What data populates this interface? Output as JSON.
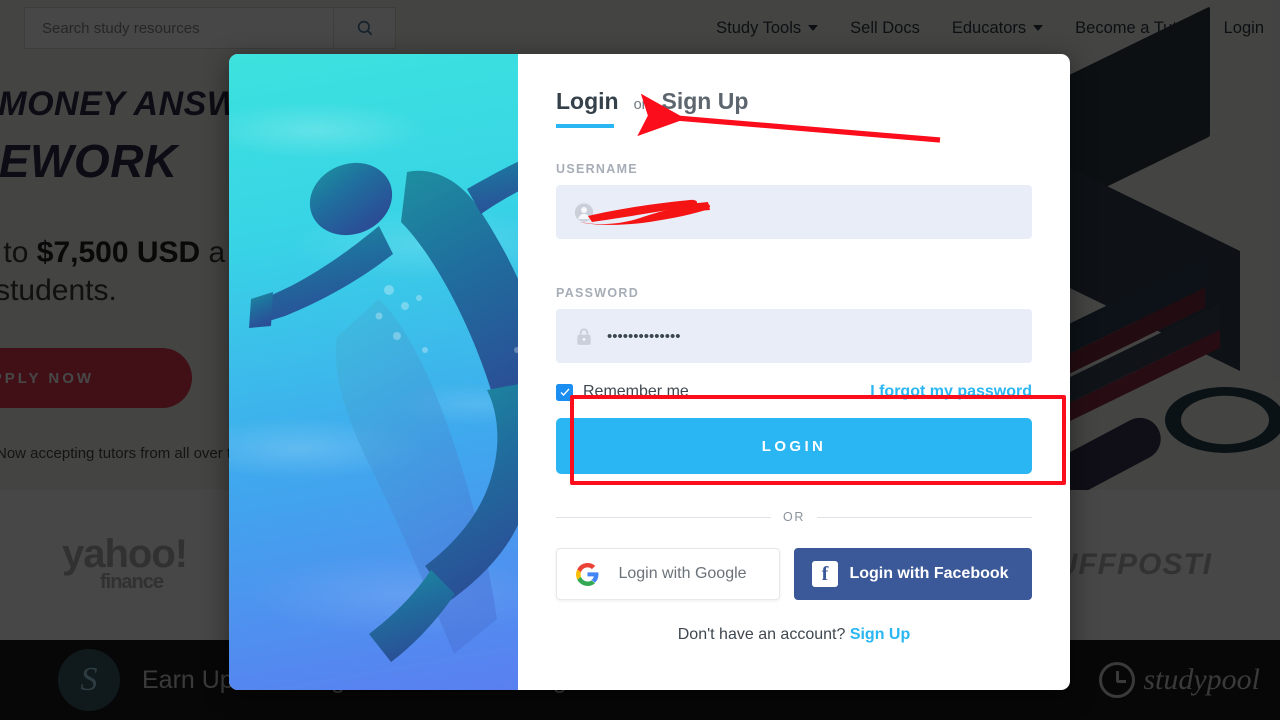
{
  "background": {
    "search": {
      "placeholder": "Search study resources",
      "value": "",
      "icon": "search-icon"
    },
    "nav": [
      {
        "label": "Study Tools",
        "has_caret": true
      },
      {
        "label": "Sell Docs",
        "has_caret": false
      },
      {
        "label": "Educators",
        "has_caret": true
      },
      {
        "label": "Become a Tutor",
        "has_caret": false
      },
      {
        "label": "Login",
        "has_caret": false
      }
    ],
    "hero": {
      "line1": "EARN MONEY ANSWERING",
      "line2": "HOMEWORK",
      "sub_prefix": "Earn up to ",
      "sub_amount": "$7,500 USD",
      "sub_suffix": " a month",
      "sub_line2": "helping students.",
      "cta": "APPLY NOW",
      "note": "Now accepting tutors from all over the world"
    },
    "logos": {
      "yahoo_main": "yahoo!",
      "yahoo_sub": "finance",
      "huffpost": "HUFFPOSTI"
    },
    "bottom_banner": {
      "icon": "swirl-icon",
      "text": "Earn Up to Six Figures Whilst Working",
      "brand": "studypool",
      "clock_icon": "clock-icon"
    }
  },
  "modal": {
    "hero_image": "surfer-silhouette-underwater",
    "tabs": {
      "login": "Login",
      "or": "or",
      "signup": "Sign Up",
      "active": "Login",
      "underline_color": "#29b6f2"
    },
    "username": {
      "label": "USERNAME",
      "icon": "person-icon",
      "value": "",
      "placeholder": "",
      "redacted": true
    },
    "password": {
      "label": "PASSWORD",
      "icon": "lock-icon",
      "value": "••••••••••••••",
      "placeholder": ""
    },
    "remember": {
      "label": "Remember me",
      "checked": true,
      "checkbox_color": "#1b8ef2"
    },
    "forgot_link": "I forgot my password",
    "login_button": {
      "label": "LOGIN",
      "color": "#29b6f2"
    },
    "divider_text": "OR",
    "social": {
      "google": {
        "label": "Login with Google",
        "icon": "google-g-icon"
      },
      "facebook": {
        "label": "Login with Facebook",
        "icon": "facebook-f-icon",
        "color": "#3b5998"
      }
    },
    "signup_prompt": {
      "text": "Don't have an account? ",
      "link": "Sign Up"
    }
  },
  "annotations": {
    "arrow": {
      "color": "#fc0d1b",
      "points_to": "login-tab"
    },
    "box": {
      "color": "#fc0d1b",
      "surrounds": "login-button"
    },
    "redaction": {
      "color": "#f51414",
      "covers": "username-value"
    }
  }
}
